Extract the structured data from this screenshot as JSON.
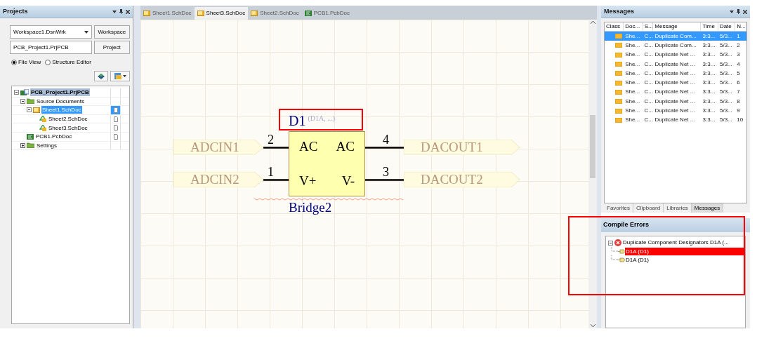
{
  "projects_panel": {
    "title": "Projects",
    "workspace_dropdown": "Workspace1.DsnWrk",
    "workspace_button": "Workspace",
    "project_field": "PCB_Project1.PrjPCB",
    "project_button": "Project",
    "view_options": [
      {
        "label": "File View",
        "selected": true
      },
      {
        "label": "Structure Editor",
        "selected": false
      }
    ],
    "tree": [
      {
        "label": "PCB_Project1.PrjPCB",
        "kind": "project",
        "expanded": true,
        "selected": false,
        "highlighted": true,
        "children": [
          {
            "label": "Source Documents",
            "kind": "folder",
            "expanded": true,
            "selected": false,
            "highlighted": false,
            "children": [
              {
                "label": "Sheet1.SchDoc",
                "kind": "sheet",
                "expanded": true,
                "selected": true,
                "children": [
                  {
                    "label": "Sheet2.SchDoc",
                    "kind": "linked-sheet",
                    "selected": false,
                    "highlighted": false
                  },
                  {
                    "label": "Sheet3.SchDoc",
                    "kind": "linked-sheet",
                    "selected": false,
                    "highlighted": false
                  }
                ]
              }
            ]
          },
          {
            "label": "PCB1.PcbDoc",
            "kind": "pcb",
            "selected": false,
            "highlighted": false
          },
          {
            "label": "Settings",
            "kind": "folder",
            "expanded": false,
            "selected": false,
            "highlighted": false
          }
        ]
      }
    ]
  },
  "document_tabs": [
    {
      "label": "Sheet1.SchDoc",
      "kind": "sheet",
      "selected": false
    },
    {
      "label": "Sheet3.SchDoc",
      "kind": "sheet",
      "selected": true
    },
    {
      "label": "Sheet2.SchDoc",
      "kind": "sheet",
      "selected": false
    },
    {
      "label": "PCB1.PcbDoc",
      "kind": "pcb",
      "selected": false
    }
  ],
  "schematic": {
    "designator": "D1",
    "designator_suffix": "(D1A, ...)",
    "comment": "Bridge2",
    "pin_rows": [
      {
        "left_port": "ADCIN1",
        "left_pin": {
          "number": "2",
          "name": "AC"
        },
        "right_pin": {
          "number": "4",
          "name": "AC"
        },
        "right_port": "DACOUT1"
      },
      {
        "left_port": "ADCIN2",
        "left_pin": {
          "number": "1",
          "name": "V+"
        },
        "right_pin": {
          "number": "3",
          "name": "V-"
        },
        "right_port": "DACOUT2"
      }
    ]
  },
  "messages_panel": {
    "title": "Messages",
    "class_column": "Class",
    "columns": [
      "Doc...",
      "S...",
      "Message",
      "Time",
      "Date",
      "N..."
    ],
    "rows": [
      {
        "cells": [
          "She...",
          "C...",
          "Duplicate Com...",
          "3:3...",
          "5/3...",
          "1"
        ],
        "selected": true
      },
      {
        "cells": [
          "She...",
          "C...",
          "Duplicate Com...",
          "3:3...",
          "5/3...",
          "2"
        ],
        "selected": false
      },
      {
        "cells": [
          "She...",
          "C...",
          "Duplicate Net ...",
          "3:3...",
          "5/3...",
          "3"
        ],
        "selected": false
      },
      {
        "cells": [
          "She...",
          "C...",
          "Duplicate Net ...",
          "3:3...",
          "5/3...",
          "4"
        ],
        "selected": false
      },
      {
        "cells": [
          "She...",
          "C...",
          "Duplicate Net ...",
          "3:3...",
          "5/3...",
          "5"
        ],
        "selected": false
      },
      {
        "cells": [
          "She...",
          "C...",
          "Duplicate Net ...",
          "3:3...",
          "5/3...",
          "6"
        ],
        "selected": false
      },
      {
        "cells": [
          "She...",
          "C...",
          "Duplicate Net ...",
          "3:3...",
          "5/3...",
          "7"
        ],
        "selected": false
      },
      {
        "cells": [
          "She...",
          "C...",
          "Duplicate Net ...",
          "3:3...",
          "5/3...",
          "8"
        ],
        "selected": false
      },
      {
        "cells": [
          "She...",
          "C...",
          "Duplicate Net ...",
          "3:3...",
          "5/3...",
          "9"
        ],
        "selected": false
      },
      {
        "cells": [
          "She...",
          "C...",
          "Duplicate Net ...",
          "3:3...",
          "5/3...",
          "10"
        ],
        "selected": false
      }
    ]
  },
  "panel_tabs": [
    {
      "label": "Favorites",
      "selected": false
    },
    {
      "label": "Clipboard",
      "selected": false
    },
    {
      "label": "Libraries",
      "selected": false
    },
    {
      "label": "Messages",
      "selected": true
    }
  ],
  "compile_errors": {
    "title": "Compile Errors",
    "error": "Duplicate Component Designators D1A (...",
    "expanded": true,
    "children": [
      {
        "label": "D1A (D1)",
        "selected": true
      },
      {
        "label": "D1A (D1)",
        "selected": false
      }
    ]
  }
}
